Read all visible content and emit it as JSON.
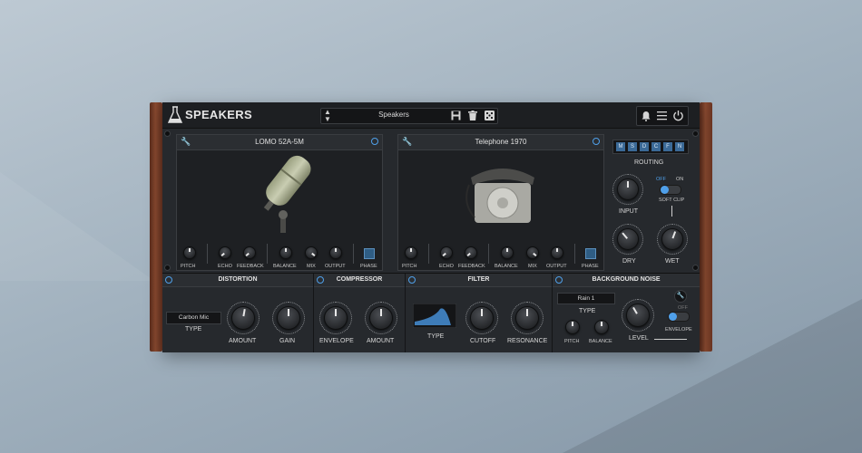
{
  "app": {
    "name": "SPEAKERS"
  },
  "preset": {
    "name": "Speakers"
  },
  "slot1": {
    "title": "LOMO 52A-5M",
    "controls": [
      "PITCH",
      "ECHO",
      "FEEDBACK",
      "BALANCE",
      "MIX",
      "OUTPUT",
      "PHASE"
    ]
  },
  "slot2": {
    "title": "Telephone 1970",
    "controls": [
      "PITCH",
      "ECHO",
      "FEEDBACK",
      "BALANCE",
      "MIX",
      "OUTPUT",
      "PHASE"
    ]
  },
  "routing": {
    "buttons": [
      "M",
      "S",
      "D",
      "C",
      "F",
      "N"
    ],
    "label": "ROUTING",
    "input_label": "INPUT",
    "off": "OFF",
    "on": "ON",
    "soft_clip": "SOFT CLIP",
    "dry_label": "DRY",
    "wet_label": "WET"
  },
  "distortion": {
    "title": "DISTORTION",
    "type_value": "Carbon Mic",
    "type_label": "TYPE",
    "amount_label": "AMOUNT",
    "gain_label": "GAIN"
  },
  "compressor": {
    "title": "COMPRESSOR",
    "envelope_label": "ENVELOPE",
    "amount_label": "AMOUNT"
  },
  "filter": {
    "title": "FILTER",
    "type_label": "TYPE",
    "cutoff_label": "CUTOFF",
    "resonance_label": "RESONANCE"
  },
  "noise": {
    "title": "BACKGROUND NOISE",
    "type_value": "Rain 1",
    "type_label": "TYPE",
    "pitch_label": "PITCH",
    "balance_label": "BALANCE",
    "level_label": "LEVEL",
    "off": "OFF",
    "envelope_label": "ENVELOPE"
  },
  "colors": {
    "accent": "#4fa0ea",
    "panel": "#26292d",
    "wood": "#8a4a30"
  },
  "icons": [
    "flask-icon",
    "up-down-arrows-icon",
    "save-icon",
    "trash-icon",
    "dice-icon",
    "bell-icon",
    "menu-icon",
    "power-icon",
    "wrench-icon"
  ]
}
